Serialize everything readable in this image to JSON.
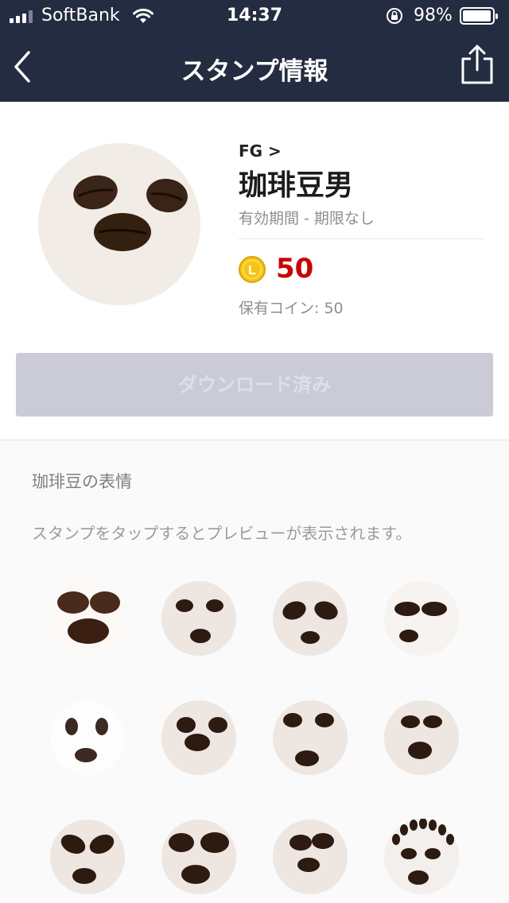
{
  "status": {
    "carrier": "SoftBank",
    "time": "14:37",
    "battery": "98%",
    "battery_level": 0.98
  },
  "nav": {
    "title": "スタンプ情報",
    "back_icon": "chevron-left-icon",
    "share_icon": "share-icon"
  },
  "product": {
    "creator": "FG >",
    "title": "珈琲豆男",
    "validity": "有効期間 - 期限なし",
    "coin_letter": "L",
    "price": "50",
    "held": "保有コイン: 50",
    "download_label": "ダウンロード済み"
  },
  "colors": {
    "header": "#232c40",
    "price": "#cc0000",
    "button": "#cbcbd8",
    "coin": "#f5c516"
  },
  "preview": {
    "section_title": "珈琲豆の表情",
    "hint": "スタンプをタップするとプレビューが表示されます。"
  }
}
